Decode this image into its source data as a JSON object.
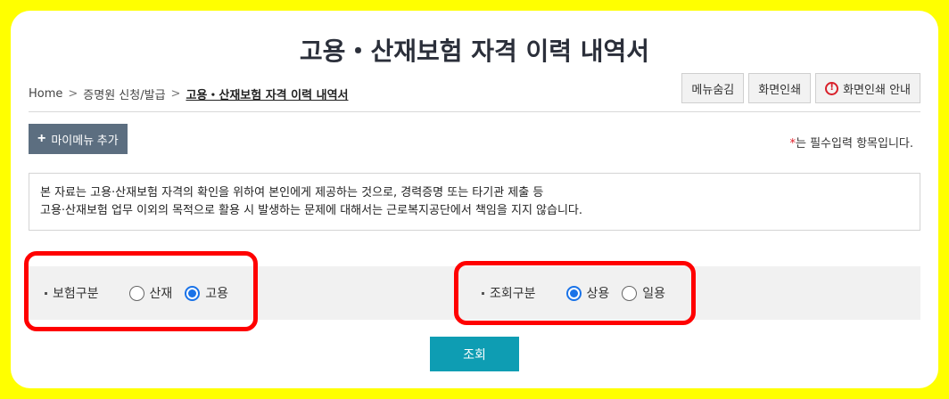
{
  "page": {
    "title": "고용・산재보험 자격 이력 내역서"
  },
  "breadcrumb": {
    "items": [
      "Home",
      "증명원 신청/발급",
      "고용・산재보험 자격 이력 내역서"
    ],
    "separator": ">"
  },
  "toolbar": {
    "menu_hide_label": "메뉴숨김",
    "print_label": "화면인쇄",
    "print_guide_label": "화면인쇄 안내",
    "print_guide_icon": "!"
  },
  "mymenu": {
    "plus": "+",
    "label": "마이메뉴 추가"
  },
  "required_note": {
    "star": "*",
    "text": "는 필수입력 항목입니다."
  },
  "notice": {
    "line1": "본 자료는 고용·산재보험 자격의 확인을 위하여 본인에게 제공하는 것으로, 경력증명 또는 타기관 제출 등",
    "line2": "고용·산재보험 업무 이외의 목적으로 활용 시 발생하는 문제에 대해서는 근로복지공단에서 책임을 지지 않습니다."
  },
  "search": {
    "insurance_type": {
      "label": "보험구분",
      "options": [
        {
          "label": "산재",
          "checked": false
        },
        {
          "label": "고용",
          "checked": true
        }
      ]
    },
    "query_type": {
      "label": "조회구분",
      "options": [
        {
          "label": "상용",
          "checked": true
        },
        {
          "label": "일용",
          "checked": false
        }
      ]
    },
    "submit_label": "조회"
  },
  "colors": {
    "frame_background": "#ffff00",
    "highlight": "#ff0000",
    "primary_button": "#0e9db3",
    "mymenu_button": "#5c6e80",
    "radio_checked": "#1a73e8"
  }
}
